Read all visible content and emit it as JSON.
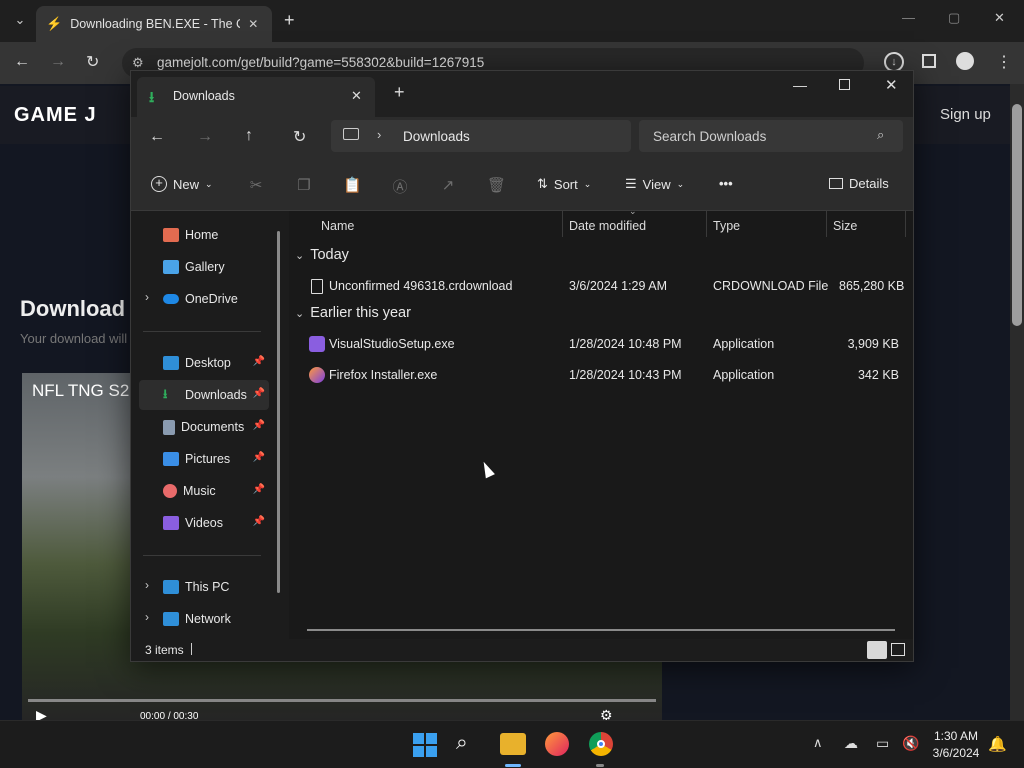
{
  "browser": {
    "tab_title": "Downloading BEN.EXE - The Co",
    "new_tab": "+",
    "url": "gamejolt.com/get/build?game=558302&build=1267915",
    "window_controls": {
      "minimize": "—",
      "maximize": "▢",
      "close": "✕"
    }
  },
  "website": {
    "logo_text": "GAME J",
    "signup": "Sign up",
    "heading": "Download",
    "subtext": "Your download will",
    "video": {
      "title": "NFL TNG S2",
      "time_current": "00:00",
      "time_separator": "/",
      "time_total": "00:30"
    }
  },
  "explorer": {
    "tab_title": "Downloads",
    "new_tab": "+",
    "breadcrumb": "Downloads",
    "search_placeholder": "Search Downloads",
    "commands": {
      "new": "New",
      "sort": "Sort",
      "view": "View",
      "more": "•••",
      "details": "Details"
    },
    "sidebar": {
      "top": [
        {
          "label": "Home",
          "icon": "home-icon",
          "color": "#e26b50"
        },
        {
          "label": "Gallery",
          "icon": "gallery-icon",
          "color": "#4aa3e8"
        },
        {
          "label": "OneDrive",
          "icon": "onedrive-icon",
          "color": "#1e88e5"
        }
      ],
      "pinned": [
        {
          "label": "Desktop",
          "icon": "desktop-icon",
          "color": "#2f8fd8"
        },
        {
          "label": "Downloads",
          "icon": "downloads-icon",
          "color": "#2fae5c"
        },
        {
          "label": "Documents",
          "icon": "documents-icon",
          "color": "#8a9bb0"
        },
        {
          "label": "Pictures",
          "icon": "pictures-icon",
          "color": "#3a8ee6"
        },
        {
          "label": "Music",
          "icon": "music-icon",
          "color": "#e86a6a"
        },
        {
          "label": "Videos",
          "icon": "videos-icon",
          "color": "#8a5ee0"
        }
      ],
      "bottom": [
        {
          "label": "This PC",
          "icon": "this-pc-icon",
          "color": "#2f8fd8"
        },
        {
          "label": "Network",
          "icon": "network-icon",
          "color": "#2f8fd8"
        }
      ]
    },
    "columns": {
      "name": "Name",
      "date": "Date modified",
      "type": "Type",
      "size": "Size"
    },
    "groups": [
      {
        "label": "Today",
        "files": [
          {
            "name": "Unconfirmed 496318.crdownload",
            "date": "3/6/2024 1:29 AM",
            "type": "CRDOWNLOAD File",
            "size": "865,280 KB"
          }
        ]
      },
      {
        "label": "Earlier this year",
        "files": [
          {
            "name": "VisualStudioSetup.exe",
            "date": "1/28/2024 10:48 PM",
            "type": "Application",
            "size": "3,909 KB"
          },
          {
            "name": "Firefox Installer.exe",
            "date": "1/28/2024 10:43 PM",
            "type": "Application",
            "size": "342 KB"
          }
        ]
      }
    ],
    "status": "3 items",
    "accent": "#2fae5c"
  },
  "taskbar": {
    "time": "1:30 AM",
    "date": "3/6/2024"
  }
}
